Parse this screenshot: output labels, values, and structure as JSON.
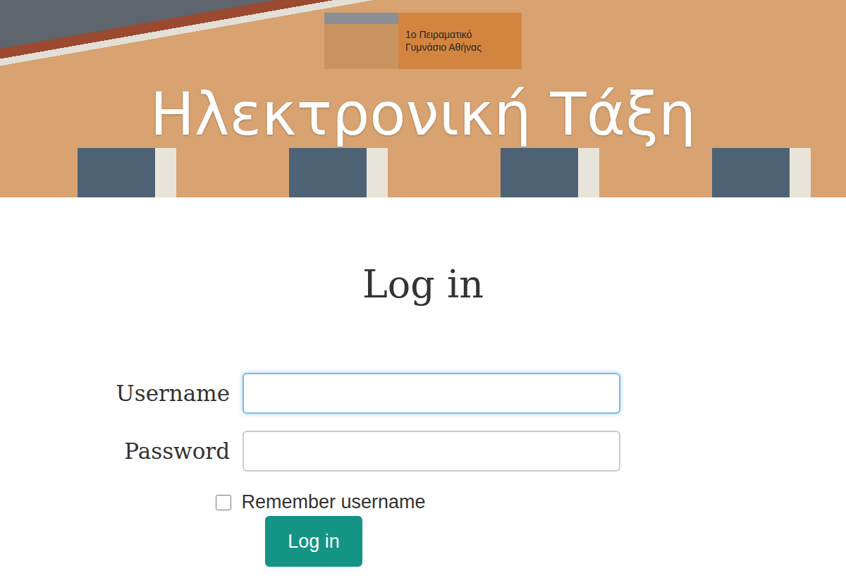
{
  "header": {
    "logo_lines": [
      "1ο Πειραματικό",
      "Γυμνάσιο Αθήνας"
    ],
    "title": "Ηλεκτρονική Τάξη"
  },
  "form": {
    "heading": "Log in",
    "fields": [
      {
        "label": "Username",
        "value": "",
        "focused": true,
        "kind": "text"
      },
      {
        "label": "Password",
        "value": "",
        "focused": false,
        "kind": "password"
      }
    ],
    "remember": {
      "label": "Remember username",
      "checked": false
    },
    "button": "Log in"
  }
}
